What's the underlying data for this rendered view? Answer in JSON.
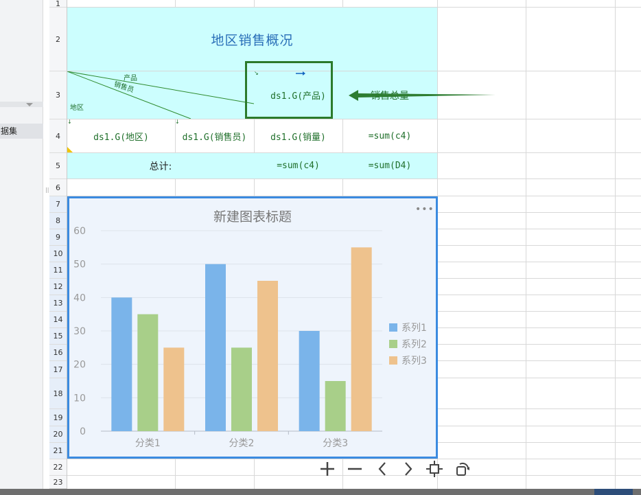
{
  "left_panel": {
    "dataset_label": "据集"
  },
  "rows": [
    "1",
    "2",
    "3",
    "4",
    "5",
    "6",
    "7",
    "8",
    "9",
    "10",
    "11",
    "12",
    "13",
    "14",
    "15",
    "16",
    "17",
    "18",
    "19",
    "20",
    "21",
    "22",
    "23"
  ],
  "report": {
    "title": "地区销售概况",
    "header_diagonal": {
      "product": "产品",
      "salesperson": "销售员",
      "region": "地区"
    },
    "product_formula": "ds1.G(产品)",
    "total_sales_label": "销售总量",
    "row4": {
      "region": "ds1.G(地区)",
      "salesperson": "ds1.G(销售员)",
      "sales": "ds1.G(销量)",
      "sum": "=sum(c4)"
    },
    "row5": {
      "label": "总计:",
      "sum_c4": "=sum(c4)",
      "sum_d4": "=sum(D4)"
    }
  },
  "chart_data": {
    "type": "bar",
    "title": "新建图表标题",
    "categories": [
      "分类1",
      "分类2",
      "分类3"
    ],
    "series": [
      {
        "name": "系列1",
        "values": [
          40,
          50,
          30
        ],
        "color": "#7ab4ea"
      },
      {
        "name": "系列2",
        "values": [
          35,
          25,
          15
        ],
        "color": "#a8cf89"
      },
      {
        "name": "系列3",
        "values": [
          25,
          45,
          55
        ],
        "color": "#eec28d"
      }
    ],
    "yticks": [
      "0",
      "10",
      "20",
      "30",
      "40",
      "50",
      "60"
    ],
    "ylim": [
      0,
      60
    ],
    "grid": true,
    "legend": "right"
  },
  "chart_toolbar": {
    "icons": [
      "plus-icon",
      "minus-icon",
      "chevron-left-icon",
      "chevron-right-icon",
      "fit-icon",
      "rotate-icon"
    ]
  },
  "colors": {
    "cell_fill": "#ccfefe",
    "formula_text": "#1f6f2a",
    "title_text": "#2a6fb8",
    "chart_border": "#3b8be0",
    "arrow": "#2e7d32"
  }
}
